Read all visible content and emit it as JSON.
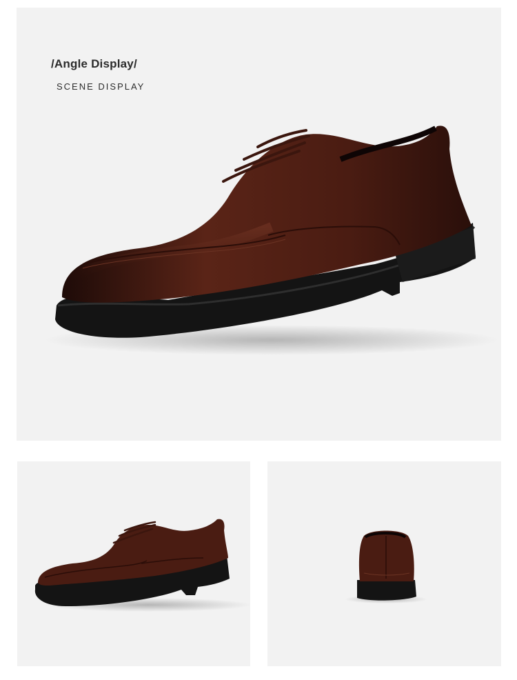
{
  "hero": {
    "title": "/Angle Display/",
    "subtitle": "SCENE DISPLAY",
    "image": "brown-leather-derby-shoe-three-quarter-view"
  },
  "thumbnails": [
    {
      "image": "brown-leather-derby-shoe-side-view"
    },
    {
      "image": "brown-leather-derby-shoe-rear-view"
    }
  ],
  "colors": {
    "panel_bg": "#f2f2f2",
    "leather": "#4a1d14",
    "sole": "#141414"
  }
}
